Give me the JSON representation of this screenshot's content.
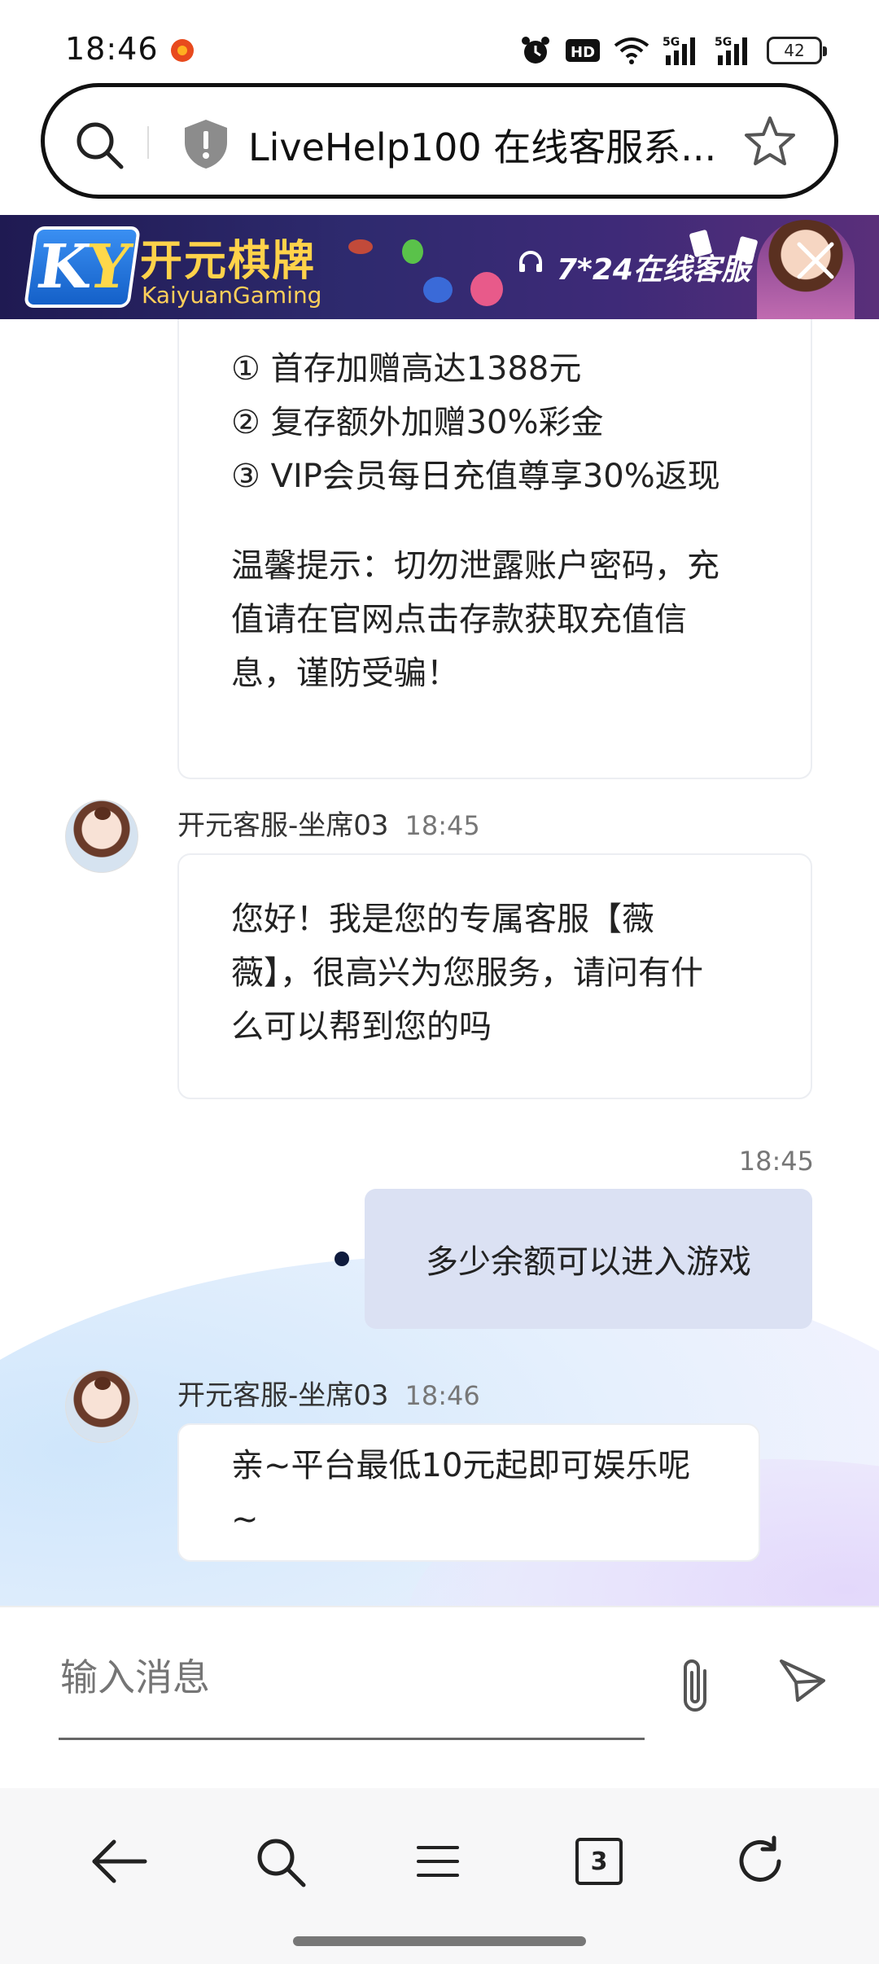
{
  "status_bar": {
    "time": "18:46",
    "battery": "42",
    "network_labels": [
      "HD",
      "5G",
      "5G"
    ]
  },
  "address_bar": {
    "title": "LiveHelp100 在线客服系..."
  },
  "banner": {
    "brand_cn": "开元棋牌",
    "brand_en": "KaiyuanGaming",
    "logo_k": "K",
    "logo_y": "Y",
    "service_text": "7*24在线客服",
    "colors": {
      "brand": "#ffd24a",
      "background": "#2e2a6e"
    }
  },
  "chat": {
    "first_message": {
      "lines": [
        "① 首存加赠高达1388元",
        "② 复存额外加赠30%彩金",
        "③ VIP会员每日充值尊享30%返现"
      ],
      "tip_lines": [
        "温馨提示：切勿泄露账户密码，充",
        "值请在官网点击存款获取充值信",
        "息，谨防受骗！"
      ]
    },
    "agent_message_1": {
      "sender": "开元客服-坐席03",
      "time": "18:45",
      "lines": [
        "您好！我是您的专属客服【薇",
        "薇】，很高兴为您服务，请问有什",
        "么可以帮到您的吗"
      ]
    },
    "user_message": {
      "time": "18:45",
      "text": "多少余额可以进入游戏"
    },
    "agent_message_2": {
      "sender": "开元客服-坐席03",
      "time": "18:46",
      "text": "亲~平台最低10元起即可娱乐呢~"
    }
  },
  "composer": {
    "placeholder": "输入消息"
  },
  "bottom_nav": {
    "tab_count": "3"
  }
}
